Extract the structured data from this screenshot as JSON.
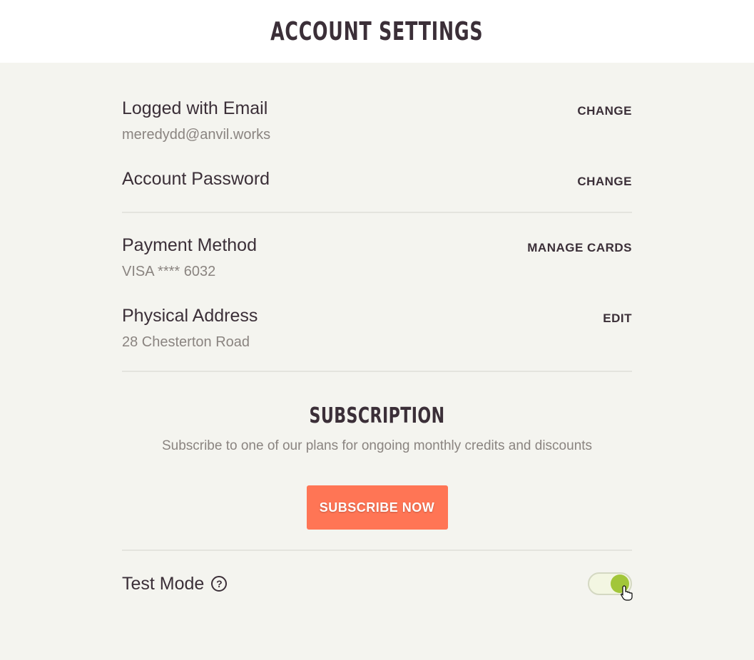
{
  "page": {
    "title": "ACCOUNT SETTINGS"
  },
  "email": {
    "label": "Logged with Email",
    "value": "meredydd@anvil.works",
    "action": "CHANGE"
  },
  "password": {
    "label": "Account Password",
    "action": "CHANGE"
  },
  "payment": {
    "label": "Payment Method",
    "value": "VISA **** 6032",
    "action": "MANAGE CARDS"
  },
  "address": {
    "label": "Physical Address",
    "value": "28 Chesterton Road",
    "action": "EDIT"
  },
  "subscription": {
    "title": "SUBSCRIPTION",
    "description": "Subscribe to one of our plans for ongoing monthly credits and discounts",
    "button": "SUBSCRIBE NOW"
  },
  "test_mode": {
    "label": "Test Mode",
    "help_glyph": "?",
    "enabled": true
  },
  "colors": {
    "background": "#f4f4ef",
    "accent_button": "#ff7555",
    "toggle_on": "#a2c63a",
    "text_dark": "#3b2f38",
    "text_muted": "#8a8480"
  },
  "icons": [
    "help-circle-icon",
    "pointer-cursor-icon"
  ]
}
